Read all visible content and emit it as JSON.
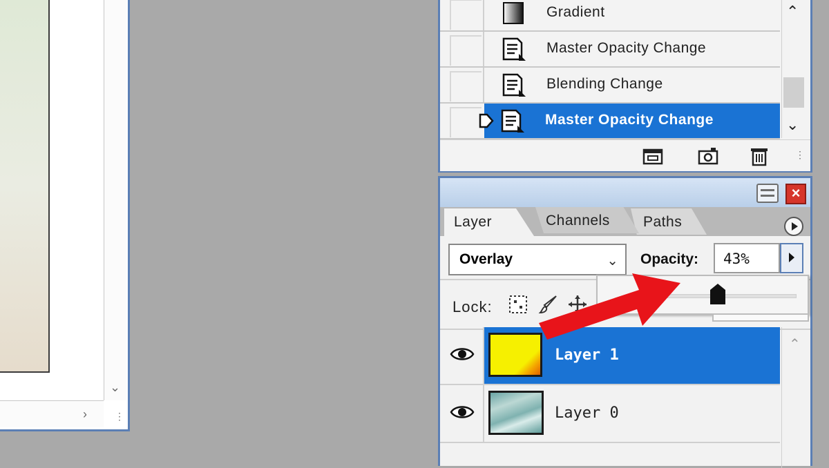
{
  "history": {
    "items": [
      {
        "label": "Gradient",
        "icon": "gradient-icon",
        "selected": false
      },
      {
        "label": "Master Opacity Change",
        "icon": "history-state-icon",
        "selected": false
      },
      {
        "label": "Blending Change",
        "icon": "history-state-icon",
        "selected": false
      },
      {
        "label": "Master Opacity Change",
        "icon": "history-state-icon",
        "selected": true
      }
    ],
    "footer_buttons": [
      "new-document-from-state-icon",
      "snapshot-icon",
      "trash-icon"
    ]
  },
  "layers_panel": {
    "tabs": [
      "Layer",
      "Channels",
      "Paths"
    ],
    "blend_mode": "Overlay",
    "opacity_label": "Opacity:",
    "opacity_value": "43%",
    "opacity_fraction": 0.43,
    "lock_label": "Lock:",
    "layers": [
      {
        "name": "Layer 1",
        "visible": true,
        "selected": true
      },
      {
        "name": "Layer 0",
        "visible": true,
        "selected": false
      }
    ]
  },
  "colors": {
    "selection": "#1a73d4",
    "window_border": "#5b7fb5",
    "annotation_arrow": "#e8141a"
  }
}
